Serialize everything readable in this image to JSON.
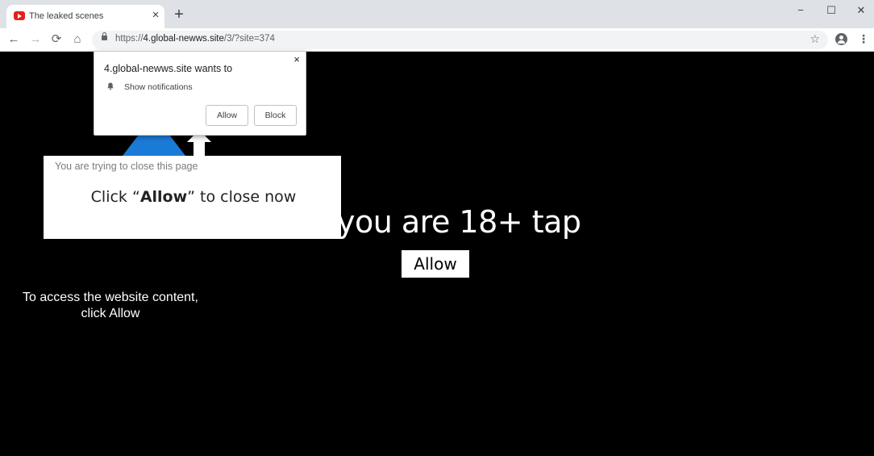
{
  "tab": {
    "title": "The leaked scenes",
    "close": "×",
    "new_tab": "+"
  },
  "window": {
    "minimize": "−",
    "maximize": "☐",
    "close": "✕"
  },
  "toolbar": {
    "back": "←",
    "forward": "→",
    "reload": "⟳",
    "home": "⌂",
    "url_scheme": "https://",
    "url_host": "4.global-newws.site",
    "url_path": "/3/?site=374",
    "bookmark": "☆",
    "menu": "⋮"
  },
  "prompt": {
    "title": "4.global-newws.site wants to",
    "permission": "Show notifications",
    "allow_label": "Allow",
    "block_label": "Block",
    "close": "×"
  },
  "overlay": {
    "top_text": "You are trying to close this page",
    "main_prefix": "Click “",
    "main_bold": "Allow",
    "main_suffix": "” to close now"
  },
  "page": {
    "headline": "you are 18+ tap",
    "allow_button": "Allow",
    "access_line1": "To access the website content,",
    "access_line2": "click Allow"
  },
  "colors": {
    "arrow_blue": "#1a7bd6",
    "page_bg": "#000000",
    "favicon_red": "#e62117"
  },
  "icons": {
    "favicon": "youtube-icon",
    "lock": "lock-icon",
    "bell": "bell-icon",
    "account": "account-icon"
  }
}
